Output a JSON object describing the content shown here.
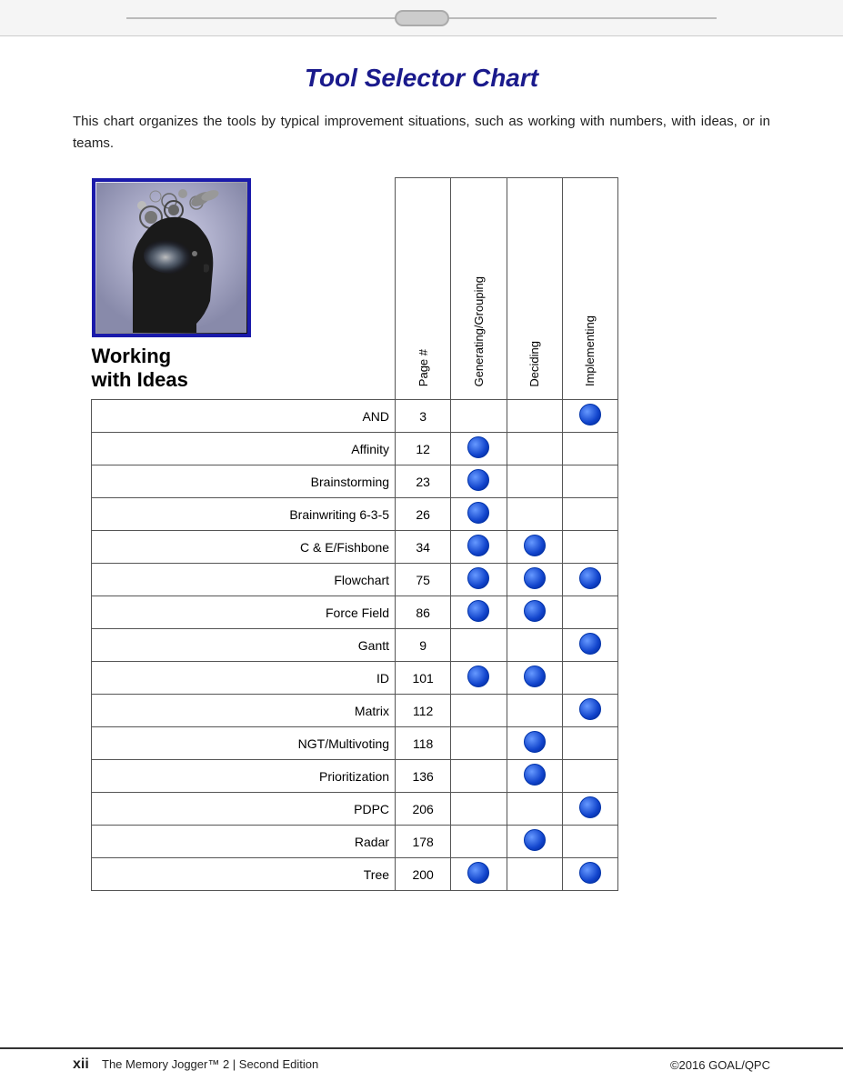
{
  "page": {
    "title": "Tool Selector Chart",
    "intro": "This chart organizes the tools by typical improvement situations, such as working with numbers, with ideas, or in teams.",
    "section_label_line1": "Working",
    "section_label_line2": "with Ideas",
    "columns": {
      "page_hash": "Page #",
      "generating": "Generating/Grouping",
      "deciding": "Deciding",
      "implementing": "Implementing"
    },
    "rows": [
      {
        "tool": "AND",
        "page": "3",
        "gen": false,
        "dec": false,
        "imp": true
      },
      {
        "tool": "Affinity",
        "page": "12",
        "gen": true,
        "dec": false,
        "imp": false
      },
      {
        "tool": "Brainstorming",
        "page": "23",
        "gen": true,
        "dec": false,
        "imp": false
      },
      {
        "tool": "Brainwriting 6-3-5",
        "page": "26",
        "gen": true,
        "dec": false,
        "imp": false
      },
      {
        "tool": "C & E/Fishbone",
        "page": "34",
        "gen": true,
        "dec": true,
        "imp": false
      },
      {
        "tool": "Flowchart",
        "page": "75",
        "gen": true,
        "dec": true,
        "imp": true
      },
      {
        "tool": "Force Field",
        "page": "86",
        "gen": true,
        "dec": true,
        "imp": false
      },
      {
        "tool": "Gantt",
        "page": "9",
        "gen": false,
        "dec": false,
        "imp": true
      },
      {
        "tool": "ID",
        "page": "101",
        "gen": true,
        "dec": true,
        "imp": false
      },
      {
        "tool": "Matrix",
        "page": "112",
        "gen": false,
        "dec": false,
        "imp": true
      },
      {
        "tool": "NGT/Multivoting",
        "page": "118",
        "gen": false,
        "dec": true,
        "imp": false
      },
      {
        "tool": "Prioritization",
        "page": "136",
        "gen": false,
        "dec": true,
        "imp": false
      },
      {
        "tool": "PDPC",
        "page": "206",
        "gen": false,
        "dec": false,
        "imp": true
      },
      {
        "tool": "Radar",
        "page": "178",
        "gen": false,
        "dec": true,
        "imp": false
      },
      {
        "tool": "Tree",
        "page": "200",
        "gen": true,
        "dec": false,
        "imp": true
      }
    ],
    "footer": {
      "page_number": "xii",
      "book_title": "The Memory Jogger™ 2  |  Second Edition",
      "copyright": "©2016 GOAL/QPC"
    }
  }
}
